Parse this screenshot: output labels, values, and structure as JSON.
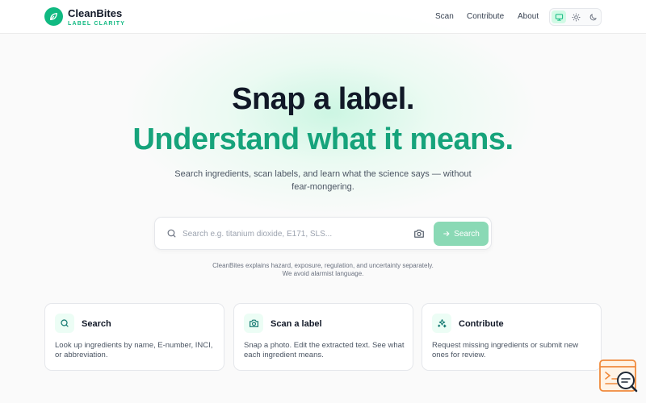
{
  "brand": {
    "name": "CleanBites",
    "tagline": "LABEL CLARITY"
  },
  "nav": {
    "items": [
      "Scan",
      "Contribute",
      "About"
    ]
  },
  "theme": {
    "options": [
      "system",
      "light",
      "dark"
    ],
    "selected": "system"
  },
  "hero": {
    "line1": "Snap a label.",
    "line2": "Understand what it means.",
    "subtitle": "Search ingredients, scan labels, and learn what the science says — without fear-mongering."
  },
  "search": {
    "placeholder": "Search e.g. titanium dioxide, E171, SLS...",
    "value": "",
    "button_label": "Search"
  },
  "note": {
    "line1": "CleanBites explains hazard, exposure, regulation, and uncertainty separately.",
    "line2": "We avoid alarmist language."
  },
  "cards": [
    {
      "icon": "search-icon",
      "title": "Search",
      "desc": "Look up ingredients by name, E-number, INCI, or abbreviation."
    },
    {
      "icon": "camera-icon",
      "title": "Scan a label",
      "desc": "Snap a photo. Edit the extracted text. See what each ingredient means."
    },
    {
      "icon": "sparkles-icon",
      "title": "Contribute",
      "desc": "Request missing ingredients or submit new ones for review."
    }
  ],
  "colors": {
    "accent": "#10b981",
    "accent_text": "#16a37b",
    "button_disabled": "#8ad9b5"
  }
}
